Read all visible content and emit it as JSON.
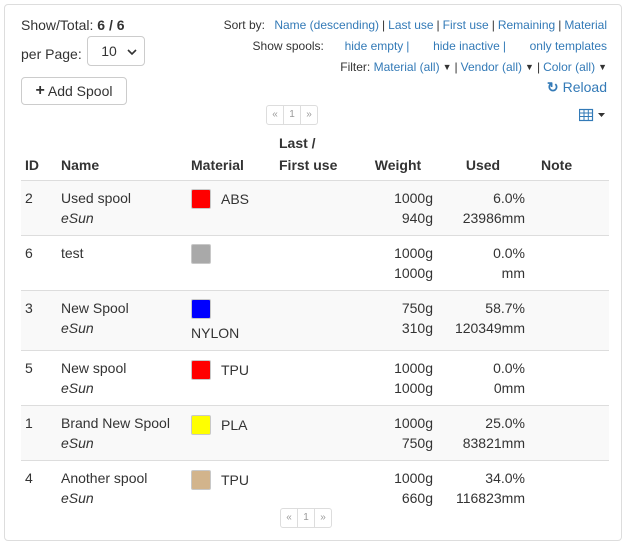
{
  "summary": {
    "show_total_label": "Show/Total:",
    "show_total_value": "6 / 6",
    "per_page_label": "per Page:",
    "per_page_value": "10"
  },
  "toolbar": {
    "add_label": "Add Spool",
    "reload_label": "Reload"
  },
  "sort": {
    "label": "Sort by:",
    "options": [
      "Name (descending)",
      "Last use",
      "First use",
      "Remaining",
      "Material"
    ]
  },
  "show_spools": {
    "label": "Show spools:",
    "options": [
      "hide empty",
      "hide inactive",
      "only templates"
    ]
  },
  "filter": {
    "label": "Filter:",
    "options": [
      "Material (all)",
      "Vendor (all)",
      "Color (all)"
    ]
  },
  "pagination": {
    "prev": "«",
    "page": "1",
    "next": "»"
  },
  "table": {
    "headers": {
      "id": "ID",
      "name": "Name",
      "material": "Material",
      "last_line1": "Last /",
      "last_line2": "First use",
      "weight": "Weight",
      "used": "Used",
      "note": "Note"
    },
    "rows": [
      {
        "id": "2",
        "name": "Used spool",
        "vendor": "eSun",
        "material": "ABS",
        "color": "#ff0000",
        "weight_total": "1000g",
        "weight_remaining": "940g",
        "used_percent": "6.0%",
        "used_length": "23986mm",
        "material_below": false
      },
      {
        "id": "6",
        "name": "test",
        "vendor": "",
        "material": "",
        "color": "#a9a9a9",
        "weight_total": "1000g",
        "weight_remaining": "1000g",
        "used_percent": "0.0%",
        "used_length": "mm",
        "material_below": false
      },
      {
        "id": "3",
        "name": "New Spool",
        "vendor": "eSun",
        "material": "NYLON",
        "color": "#0000ff",
        "weight_total": "750g",
        "weight_remaining": "310g",
        "used_percent": "58.7%",
        "used_length": "120349mm",
        "material_below": true
      },
      {
        "id": "5",
        "name": "New spool",
        "vendor": "eSun",
        "material": "TPU",
        "color": "#ff0000",
        "weight_total": "1000g",
        "weight_remaining": "1000g",
        "used_percent": "0.0%",
        "used_length": "0mm",
        "material_below": false
      },
      {
        "id": "1",
        "name": "Brand New Spool",
        "vendor": "eSun",
        "material": "PLA",
        "color": "#ffff00",
        "weight_total": "1000g",
        "weight_remaining": "750g",
        "used_percent": "25.0%",
        "used_length": "83821mm",
        "material_below": false
      },
      {
        "id": "4",
        "name": "Another spool",
        "vendor": "eSun",
        "material": "TPU",
        "color": "#d2b48c",
        "weight_total": "1000g",
        "weight_remaining": "660g",
        "used_percent": "34.0%",
        "used_length": "116823mm",
        "material_below": false
      }
    ]
  }
}
